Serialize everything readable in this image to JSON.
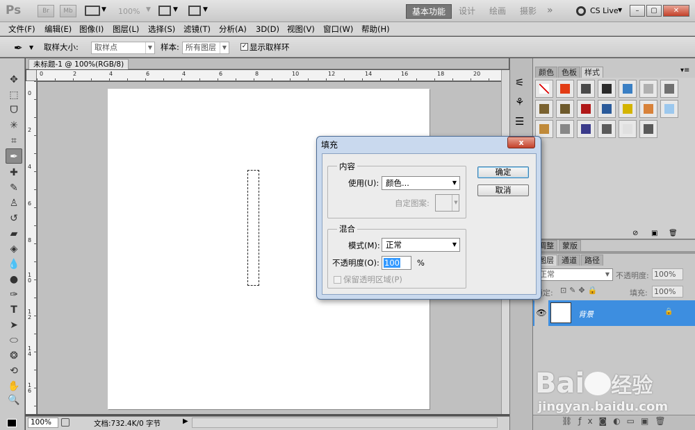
{
  "app": {
    "logo": "Ps",
    "br": "Br",
    "mb": "Mb",
    "zoom_level": "100%",
    "workspaces": [
      "基本功能",
      "设计",
      "绘画",
      "摄影"
    ],
    "more": "»",
    "cslive": "CS Live",
    "window_buttons": [
      "–",
      "▢",
      "✕"
    ]
  },
  "menu": [
    "文件(F)",
    "编辑(E)",
    "图像(I)",
    "图层(L)",
    "选择(S)",
    "滤镜(T)",
    "分析(A)",
    "3D(D)",
    "视图(V)",
    "窗口(W)",
    "帮助(H)"
  ],
  "options": {
    "sample_size_label": "取样大小:",
    "sample_size_value": "取样点",
    "sample_label": "样本:",
    "sample_value": "所有图层",
    "show_ring_label": "显示取样环",
    "show_ring_checked": true
  },
  "document": {
    "tab_title": "未标题-1 @ 100%(RGB/8)",
    "h_ruler_labels": [
      "0",
      "2",
      "4",
      "6",
      "8",
      "10",
      "12",
      "14",
      "16",
      "18",
      "20"
    ],
    "v_ruler_labels": [
      "0",
      "2",
      "4",
      "6",
      "8",
      "1\n0",
      "1\n2",
      "1\n4",
      "1\n6"
    ],
    "status_zoom": "100%",
    "status_doc": "文档:732.4K/0 字节"
  },
  "panels": {
    "top_tabs": [
      "颜色",
      "色板",
      "样式"
    ],
    "active_top_tab": "样式",
    "style_colors": [
      "#ffffff",
      "#e23c14",
      "#4a4a4a",
      "#2a2a2a",
      "#3a7fc4",
      "#b0b0b0",
      "#707070",
      "#7a6230",
      "#6e5a2c",
      "#b01818",
      "#2a5a9a",
      "#d4b400",
      "#d8823a",
      "#9cc8ee",
      "#c08a3a",
      "#888888",
      "#3a3a8a",
      "#5a5a5a",
      "#e0e0e0",
      "#5a5a5a"
    ],
    "mid_tabs": [
      "调整",
      "蒙版"
    ],
    "layer_tabs": [
      "图层",
      "通道",
      "路径"
    ],
    "blend_mode": "正常",
    "opacity_label": "不透明度:",
    "opacity_value": "100%",
    "lock_label": "锁定:",
    "fill_label": "填充:",
    "fill_value": "100%",
    "layer_name": "背景"
  },
  "dialog": {
    "title": "填充",
    "close": "x",
    "content_group": "内容",
    "use_label": "使用(U):",
    "use_value": "颜色...",
    "custom_pattern_label": "自定图案:",
    "blend_group": "混合",
    "mode_label": "模式(M):",
    "mode_value": "正常",
    "opacity_label": "不透明度(O):",
    "opacity_value": "100",
    "percent": "%",
    "preserve_label": "保留透明区域(P)",
    "ok": "确定",
    "cancel": "取消"
  },
  "watermark": {
    "brand": "Bai",
    "brand2": "经验",
    "url": "jingyan.baidu.com"
  }
}
